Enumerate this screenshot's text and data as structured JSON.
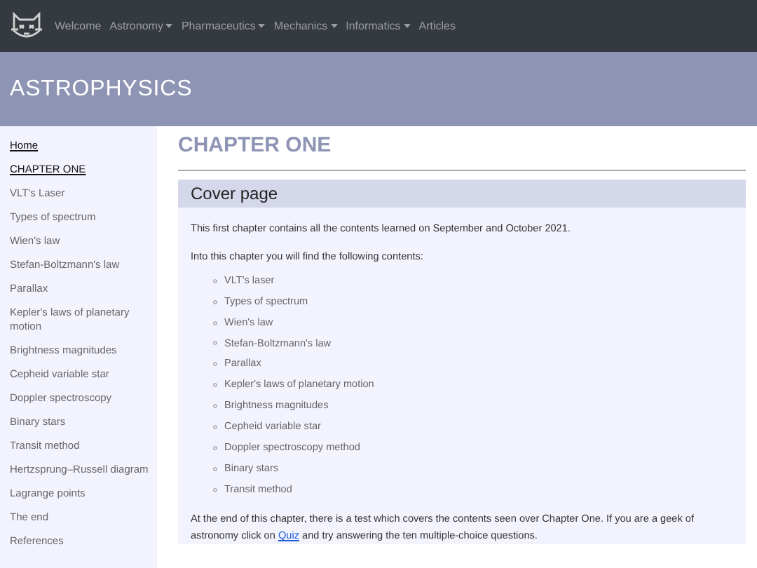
{
  "navbar": {
    "items": [
      {
        "label": "Welcome",
        "kind": "link"
      },
      {
        "label": "Astronomy",
        "kind": "dropdown"
      },
      {
        "label": "Pharmaceutics",
        "kind": "dropdown"
      },
      {
        "label": "Mechanics",
        "kind": "dropdown"
      },
      {
        "label": "Informatics",
        "kind": "dropdown"
      },
      {
        "label": "Articles",
        "kind": "link"
      }
    ]
  },
  "banner": {
    "title": "ASTROPHYSICS"
  },
  "sidebar": {
    "items": [
      {
        "label": "Home",
        "kind": "heading"
      },
      {
        "label": "CHAPTER ONE",
        "kind": "heading"
      },
      {
        "label": "VLT's Laser",
        "kind": "link"
      },
      {
        "label": "Types of spectrum",
        "kind": "link"
      },
      {
        "label": "Wien's law",
        "kind": "link"
      },
      {
        "label": "Stefan-Boltzmann's law",
        "kind": "link"
      },
      {
        "label": "Parallax",
        "kind": "link"
      },
      {
        "label": "Kepler's laws of planetary motion",
        "kind": "link"
      },
      {
        "label": "Brightness magnitudes",
        "kind": "link"
      },
      {
        "label": "Cepheid variable star",
        "kind": "link"
      },
      {
        "label": "Doppler spectroscopy",
        "kind": "link"
      },
      {
        "label": "Binary stars",
        "kind": "link"
      },
      {
        "label": "Transit method",
        "kind": "link"
      },
      {
        "label": "Hertzsprung–Russell diagram",
        "kind": "link"
      },
      {
        "label": "Lagrange points",
        "kind": "link"
      },
      {
        "label": "The end",
        "kind": "link"
      },
      {
        "label": "References",
        "kind": "link"
      }
    ]
  },
  "main": {
    "title": "CHAPTER ONE",
    "card": {
      "title": "Cover page",
      "intro": "This first chapter contains all the contents learned on September and October 2021.",
      "lead": "Into this chapter you will find the following contents:",
      "contents": [
        "VLT's laser",
        "Types of spectrum",
        "Wien's law",
        "Stefan-Boltzmann's law",
        "Parallax",
        "Kepler's laws of planetary motion",
        "Brightness magnitudes",
        "Cepheid variable star",
        "Doppler spectroscopy method",
        "Binary stars",
        "Transit method"
      ],
      "outro": {
        "before": "At the end of this chapter, there is a test which covers the contents seen over Chapter One. If you are a geek of astronomy click on",
        "link": "Quiz",
        "after": "and try answering the ten multiple-choice questions."
      }
    }
  }
}
